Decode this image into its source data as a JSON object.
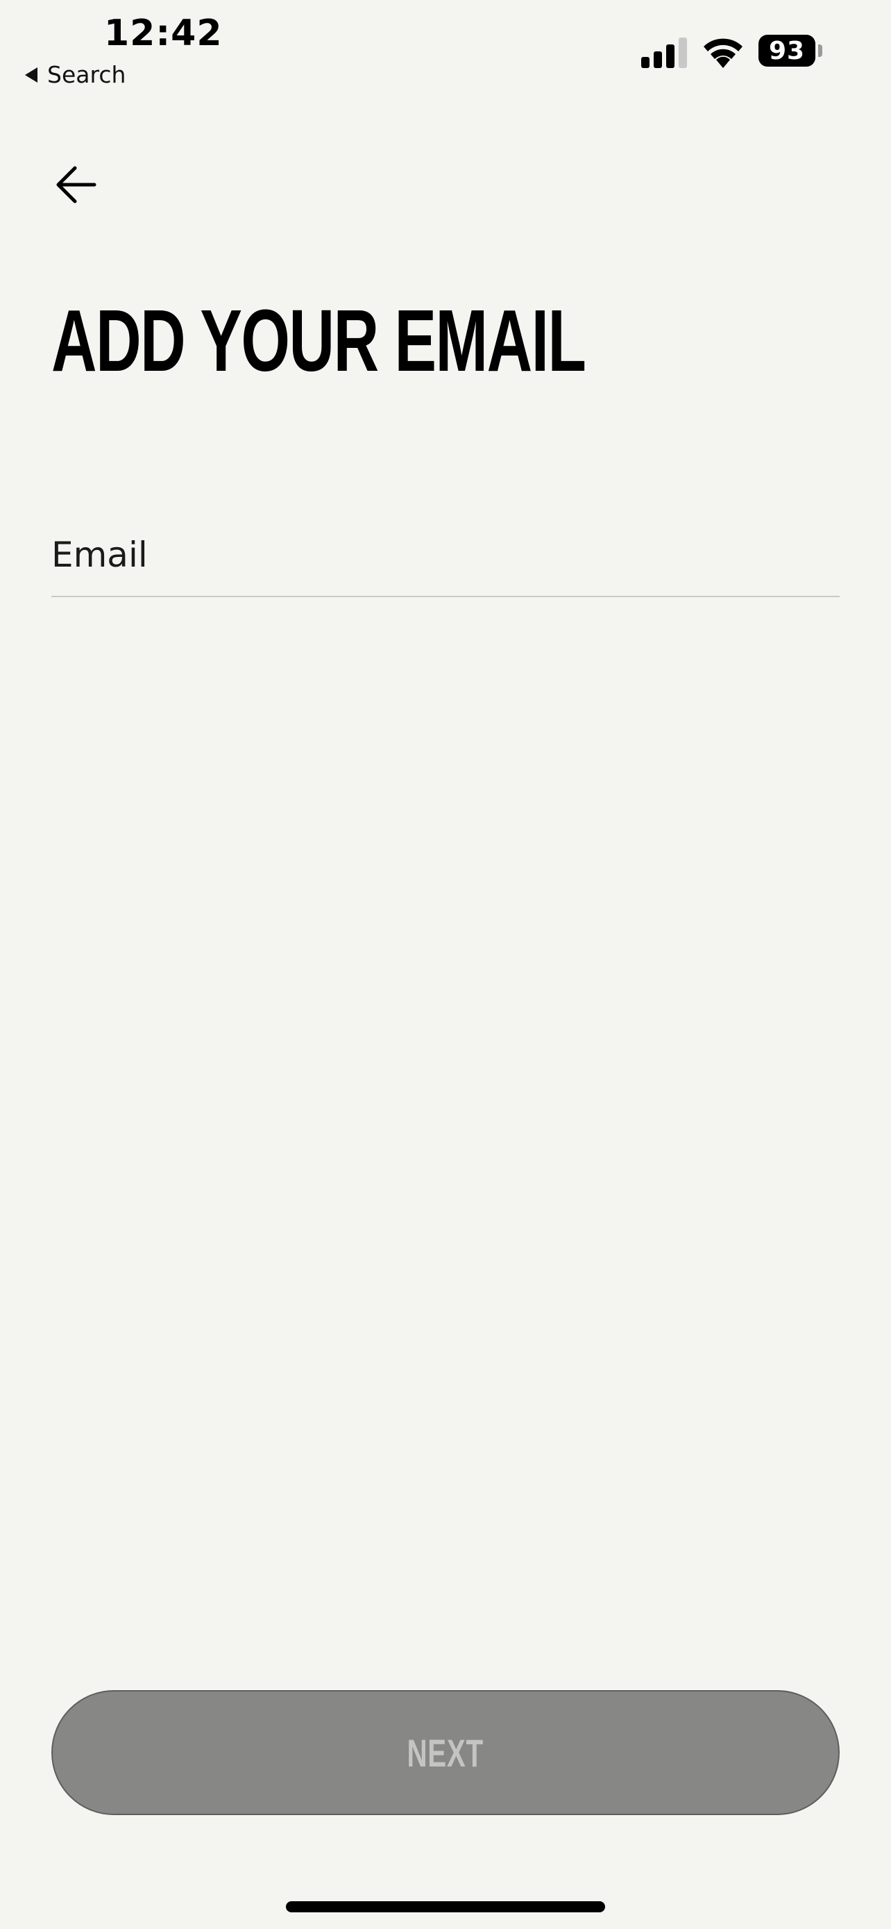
{
  "status_bar": {
    "time": "12:42",
    "back_app_label": "Search",
    "battery_level": "93",
    "signal_bars_filled": 3,
    "signal_bars_total": 4
  },
  "screen": {
    "title": "ADD YOUR EMAIL",
    "email_placeholder": "Email",
    "email_value": "",
    "next_label": "NEXT"
  },
  "colors": {
    "background": "#f4f4f1",
    "button_disabled": "#878786",
    "button_label_disabled": "#c4c4c2"
  },
  "icons": {
    "back": "arrow-left-icon",
    "signal": "cellular-signal-icon",
    "wifi": "wifi-icon",
    "battery": "battery-icon"
  }
}
